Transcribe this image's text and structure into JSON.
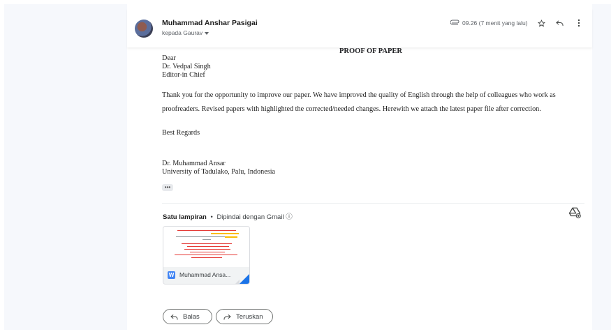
{
  "email": {
    "sender_name": "Muhammad Anshar Pasigai",
    "recipient_line": "kepada Gaurav",
    "time": "09.26 (7 menit yang lalu)",
    "icons": {
      "attachment": "paperclip-icon",
      "star": "star-icon",
      "reply": "reply-icon",
      "more": "more-vert-icon"
    }
  },
  "body": {
    "doc_title": "PROOF OF PAPER",
    "salutation": [
      "Dear",
      "Dr. Vedpal Singh",
      "Editor-in Chief"
    ],
    "paragraph": "Thank you for the opportunity to improve our paper. We have improved the quality of English through the help of colleagues who work as proofreaders. Revised papers with highlighted the corrected/needed changes. Herewith we attach the latest paper file after correction.",
    "closing": "Best Regards",
    "signature": [
      "Dr. Muhammad Ansar",
      "University of  Tadulako, Palu, Indonesia"
    ],
    "more_label": "•••"
  },
  "attachments": {
    "count_label": "Satu lampiran",
    "separator": "•",
    "scan_label": "Dipindai dengan Gmail",
    "info_icon": "ⓘ",
    "file_name": "Muhammad Ansa...",
    "file_type_letter": "W",
    "add_to_drive_icon": "add-to-drive-icon"
  },
  "actions": {
    "reply_label": "Balas",
    "forward_label": "Teruskan"
  },
  "colors": {
    "side_panel": "#f6f8fc",
    "word_blue": "#4285f4",
    "drive_blue": "#1a73e8",
    "thumb_red": "#e53935",
    "thumb_highlight": "#fbbc04"
  }
}
